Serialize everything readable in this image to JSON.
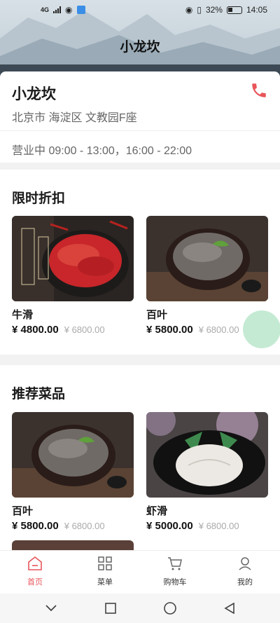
{
  "status": {
    "network": "4G",
    "battery": "32%",
    "time": "14:05"
  },
  "app": {
    "title": "小龙坎"
  },
  "shop": {
    "name": "小龙坎",
    "address": "北京市 海淀区 文教园F座",
    "hours": "营业中 09:00 - 13:00，16:00 - 22:00",
    "phone_icon": "phone-icon"
  },
  "discount": {
    "title": "限时折扣",
    "dishes": [
      {
        "name": "牛滑",
        "price": "¥ 4800.00",
        "orig": "¥ 6800.00"
      },
      {
        "name": "百叶",
        "price": "¥ 5800.00",
        "orig": "¥ 6800.00"
      }
    ]
  },
  "recommend": {
    "title": "推荐菜品",
    "dishes": [
      {
        "name": "百叶",
        "price": "¥ 5800.00",
        "orig": "¥ 6800.00"
      },
      {
        "name": "虾滑",
        "price": "¥ 5000.00",
        "orig": "¥ 6800.00"
      }
    ]
  },
  "tabs": [
    {
      "label": "首页",
      "icon": "home-icon",
      "active": true
    },
    {
      "label": "菜单",
      "icon": "menu-grid-icon",
      "active": false
    },
    {
      "label": "购物车",
      "icon": "cart-icon",
      "active": false
    },
    {
      "label": "我的",
      "icon": "user-icon",
      "active": false
    }
  ],
  "colors": {
    "accent": "#e8555a",
    "fab": "#bfe8cf"
  }
}
